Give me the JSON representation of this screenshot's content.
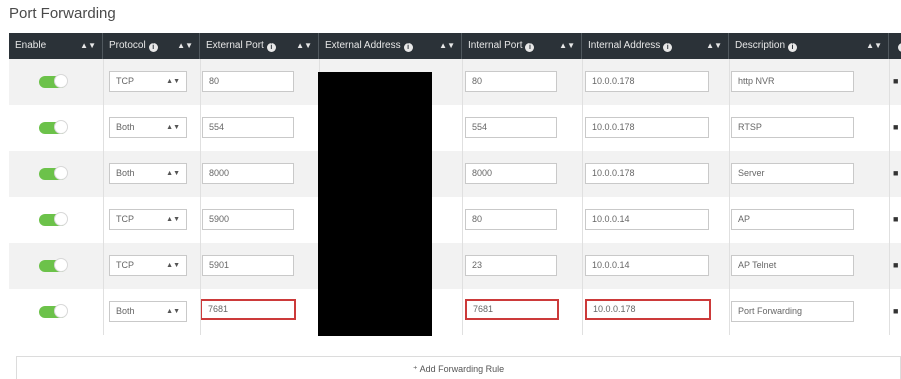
{
  "page": {
    "title": "Port Forwarding"
  },
  "columns": [
    {
      "label": "Enable",
      "info": false
    },
    {
      "label": "Protocol",
      "info": true
    },
    {
      "label": "External Port",
      "info": true
    },
    {
      "label": "External Address",
      "info": true
    },
    {
      "label": "Internal Port",
      "info": true
    },
    {
      "label": "Internal Address",
      "info": true
    },
    {
      "label": "Description",
      "info": true
    }
  ],
  "rows": [
    {
      "enabled": true,
      "protocol": "TCP",
      "external_port": "80",
      "internal_port": "80",
      "internal_address": "10.0.0.178",
      "description": "http NVR"
    },
    {
      "enabled": true,
      "protocol": "Both",
      "external_port": "554",
      "internal_port": "554",
      "internal_address": "10.0.0.178",
      "description": "RTSP"
    },
    {
      "enabled": true,
      "protocol": "Both",
      "external_port": "8000",
      "internal_port": "8000",
      "internal_address": "10.0.0.178",
      "description": "Server"
    },
    {
      "enabled": true,
      "protocol": "TCP",
      "external_port": "5900",
      "internal_port": "80",
      "internal_address": "10.0.0.14",
      "description": "AP"
    },
    {
      "enabled": true,
      "protocol": "TCP",
      "external_port": "5901",
      "internal_port": "23",
      "internal_address": "10.0.0.14",
      "description": "AP Telnet"
    },
    {
      "enabled": true,
      "protocol": "Both",
      "external_port": "7681",
      "internal_port": "7681",
      "internal_address": "10.0.0.178",
      "description": "Port Forwarding"
    }
  ],
  "add_rule": {
    "label": "Add Forwarding Rule"
  },
  "colors": {
    "header_bg": "#2b3238",
    "toggle_on": "#6cc24a",
    "highlight": "#cc3a3a",
    "alt_row": "#f2f2f2"
  },
  "icons": {
    "sort": "sort-arrows-icon",
    "info": "info-icon",
    "delete": "trash-icon",
    "add": "plus-icon"
  }
}
